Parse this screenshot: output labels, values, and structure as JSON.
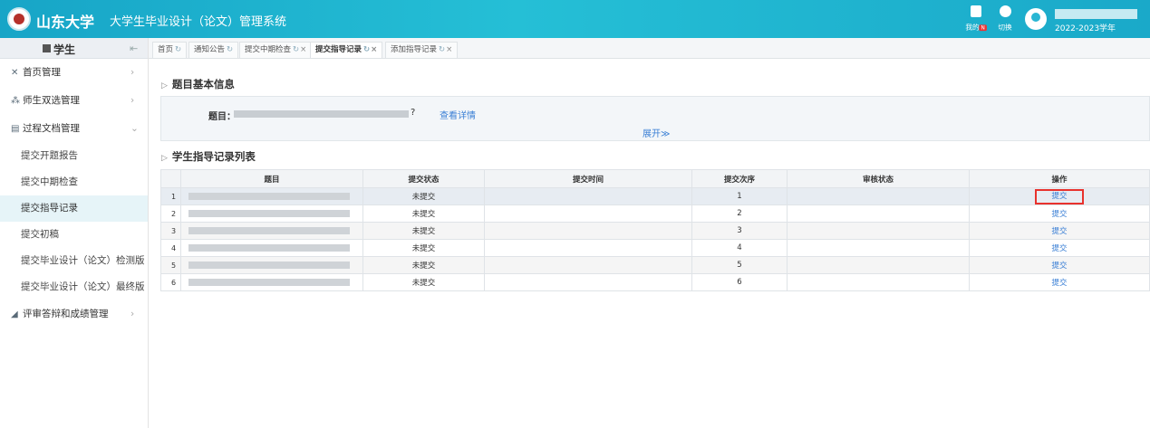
{
  "header": {
    "university": "山东大学",
    "system_title": "大学生毕业设计（论文）管理系统",
    "icons": [
      {
        "name": "message-icon",
        "label": "我的",
        "badge": "N"
      },
      {
        "name": "switch-icon",
        "label": "切换"
      }
    ],
    "academic_year": "2022-2023学年"
  },
  "sidebar": {
    "role": "学生",
    "menu": [
      {
        "label": "首页管理",
        "icon": "home-icon"
      },
      {
        "label": "师生双选管理",
        "icon": "users-icon"
      },
      {
        "label": "过程文档管理",
        "icon": "document-icon",
        "expanded": true,
        "children": [
          "提交开题报告",
          "提交中期检查",
          "提交指导记录",
          "提交初稿",
          "提交毕业设计（论文）检测版",
          "提交毕业设计（论文）最终版"
        ]
      },
      {
        "label": "评审答辩和成绩管理",
        "icon": "chart-icon"
      }
    ],
    "active_child": "提交指导记录"
  },
  "tabs": [
    {
      "label": "首页",
      "closable": false
    },
    {
      "label": "通知公告",
      "closable": false
    },
    {
      "label": "提交中期检查",
      "closable": true
    },
    {
      "label": "提交指导记录",
      "closable": true,
      "active": true
    },
    {
      "label": "添加指导记录",
      "closable": true
    }
  ],
  "topic_section": {
    "title": "题目基本信息",
    "topic_label": "题目：",
    "topic_suffix": "?",
    "detail_link": "查看详情",
    "expand": "展开"
  },
  "list_section": {
    "title": "学生指导记录列表",
    "columns": [
      "题目",
      "提交状态",
      "提交时间",
      "提交次序",
      "审核状态",
      "操作"
    ],
    "rows": [
      {
        "index": "1",
        "status": "未提交",
        "time": "",
        "order": "1",
        "review": "",
        "action": "提交"
      },
      {
        "index": "2",
        "status": "未提交",
        "time": "",
        "order": "2",
        "review": "",
        "action": "提交"
      },
      {
        "index": "3",
        "status": "未提交",
        "time": "",
        "order": "3",
        "review": "",
        "action": "提交"
      },
      {
        "index": "4",
        "status": "未提交",
        "time": "",
        "order": "4",
        "review": "",
        "action": "提交"
      },
      {
        "index": "5",
        "status": "未提交",
        "time": "",
        "order": "5",
        "review": "",
        "action": "提交"
      },
      {
        "index": "6",
        "status": "未提交",
        "time": "",
        "order": "6",
        "review": "",
        "action": "提交"
      }
    ]
  },
  "colors": {
    "header": "#1fb3cf",
    "link": "#3a7fd5",
    "highlight_border": "#e8322d"
  }
}
